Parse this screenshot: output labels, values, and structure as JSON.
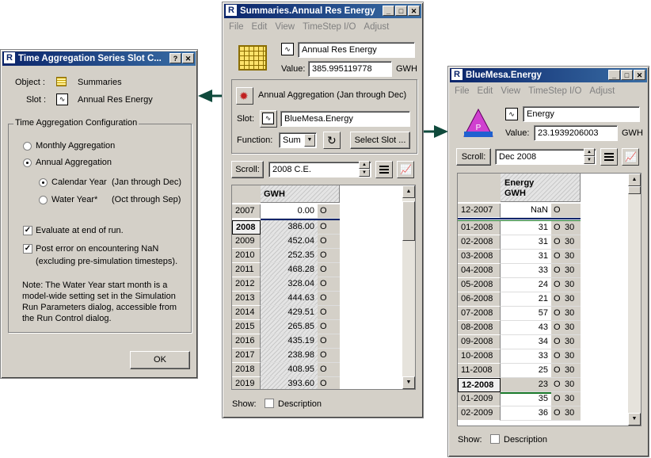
{
  "agg_dialog": {
    "title": "Time Aggregation Series Slot C...",
    "object_label": "Object :",
    "object_value": "Summaries",
    "slot_label": "Slot :",
    "slot_value": "Annual Res Energy",
    "group_label": "Time Aggregation Configuration",
    "monthly_label": "Monthly Aggregation",
    "annual_label": "Annual Aggregation",
    "calendar_label": "Calendar Year",
    "calendar_range": "(Jan through Dec)",
    "water_label": "Water Year*",
    "water_range": "(Oct through Sep)",
    "evaluate_label": "Evaluate at end of run.",
    "post_error_line1": "Post error on encountering NaN",
    "post_error_line2": "(excluding pre-simulation timesteps).",
    "note_lines": [
      "Note: The Water Year start month is a",
      "model-wide setting set in the Simulation",
      "Run Parameters dialog, accessible from",
      "the Run Control dialog."
    ],
    "ok_label": "OK"
  },
  "summaries": {
    "title": "Summaries.Annual Res Energy",
    "menu": [
      "File",
      "Edit",
      "View",
      "TimeStep I/O",
      "Adjust"
    ],
    "slot_name": "Annual Res Energy",
    "value_label": "Value:",
    "value": "385.995119778",
    "unit": "GWH",
    "aggregation_label": "Annual Aggregation (Jan through Dec)",
    "slot_label": "Slot:",
    "slot_value": "BlueMesa.Energy",
    "function_label": "Function:",
    "function_value": "Sum",
    "select_slot_label": "Select Slot ...",
    "scroll_label": "Scroll:",
    "scroll_value": "2008 C.E.",
    "column_header": "GWH",
    "rows": [
      {
        "date": "2007",
        "value": "0.00",
        "flag": "O"
      },
      {
        "date": "2008",
        "value": "386.00",
        "flag": "O"
      },
      {
        "date": "2009",
        "value": "452.04",
        "flag": "O"
      },
      {
        "date": "2010",
        "value": "252.35",
        "flag": "O"
      },
      {
        "date": "2011",
        "value": "468.28",
        "flag": "O"
      },
      {
        "date": "2012",
        "value": "328.04",
        "flag": "O"
      },
      {
        "date": "2013",
        "value": "444.63",
        "flag": "O"
      },
      {
        "date": "2014",
        "value": "429.51",
        "flag": "O"
      },
      {
        "date": "2015",
        "value": "265.85",
        "flag": "O"
      },
      {
        "date": "2016",
        "value": "435.19",
        "flag": "O"
      },
      {
        "date": "2017",
        "value": "238.98",
        "flag": "O"
      },
      {
        "date": "2018",
        "value": "408.95",
        "flag": "O"
      },
      {
        "date": "2019",
        "value": "393.60",
        "flag": "O"
      }
    ],
    "show_label": "Show:",
    "description_label": "Description"
  },
  "bluemesa": {
    "title": "BlueMesa.Energy",
    "menu": [
      "File",
      "Edit",
      "View",
      "TimeStep I/O",
      "Adjust"
    ],
    "slot_name": "Energy",
    "value_label": "Value:",
    "value": "23.1939206003",
    "unit": "GWH",
    "scroll_label": "Scroll:",
    "scroll_value": "Dec 2008",
    "column_header_1": "Energy",
    "column_header_2": "GWH",
    "rows": [
      {
        "date": "12-2007",
        "value": "NaN",
        "flag": "O",
        "days": ""
      },
      {
        "date": "01-2008",
        "value": "31",
        "flag": "O",
        "days": "30"
      },
      {
        "date": "02-2008",
        "value": "31",
        "flag": "O",
        "days": "30"
      },
      {
        "date": "03-2008",
        "value": "31",
        "flag": "O",
        "days": "30"
      },
      {
        "date": "04-2008",
        "value": "33",
        "flag": "O",
        "days": "30"
      },
      {
        "date": "05-2008",
        "value": "24",
        "flag": "O",
        "days": "30"
      },
      {
        "date": "06-2008",
        "value": "21",
        "flag": "O",
        "days": "30"
      },
      {
        "date": "07-2008",
        "value": "57",
        "flag": "O",
        "days": "30"
      },
      {
        "date": "08-2008",
        "value": "43",
        "flag": "O",
        "days": "30"
      },
      {
        "date": "09-2008",
        "value": "34",
        "flag": "O",
        "days": "30"
      },
      {
        "date": "10-2008",
        "value": "33",
        "flag": "O",
        "days": "30"
      },
      {
        "date": "11-2008",
        "value": "25",
        "flag": "O",
        "days": "30"
      },
      {
        "date": "12-2008",
        "value": "23",
        "flag": "O",
        "days": "30"
      },
      {
        "date": "01-2009",
        "value": "35",
        "flag": "O",
        "days": "30"
      },
      {
        "date": "02-2009",
        "value": "36",
        "flag": "O",
        "days": "30"
      }
    ],
    "show_label": "Show:",
    "description_label": "Description"
  },
  "colors": {
    "titlebar": "#0a246a",
    "arrow": "#0f4a3c",
    "sum_row_line": "#1a7a2a",
    "highlight_row": "#d4d0c8"
  }
}
